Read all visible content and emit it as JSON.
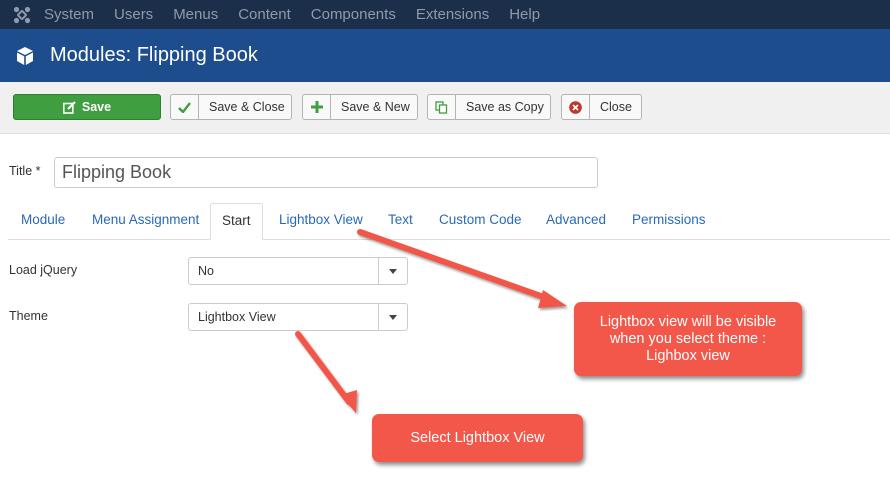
{
  "topnav": {
    "items": [
      "System",
      "Users",
      "Menus",
      "Content",
      "Components",
      "Extensions",
      "Help"
    ]
  },
  "header": {
    "title": "Modules: Flipping Book"
  },
  "toolbar": {
    "save": "Save",
    "save_close": "Save & Close",
    "save_new": "Save & New",
    "save_copy": "Save as Copy",
    "close": "Close"
  },
  "form": {
    "title_label": "Title *",
    "title_value": "Flipping Book"
  },
  "tabs": [
    "Module",
    "Menu Assignment",
    "Start",
    "Lightbox View",
    "Text",
    "Custom Code",
    "Advanced",
    "Permissions"
  ],
  "active_tab": "Start",
  "fields": {
    "load_jquery_label": "Load jQuery",
    "load_jquery_value": "No",
    "theme_label": "Theme",
    "theme_value": "Lightbox View"
  },
  "annotations": {
    "callout_1": "Lightbox view will be visible when you select theme : Lighbox view",
    "callout_2": "Select Lightbox View"
  },
  "colors": {
    "topnav_bg": "#1b2e4a",
    "header_bg": "#1d4d8d",
    "save_green": "#3f9e3f",
    "callout_red": "#f2574a",
    "tab_link": "#2a69b8"
  }
}
